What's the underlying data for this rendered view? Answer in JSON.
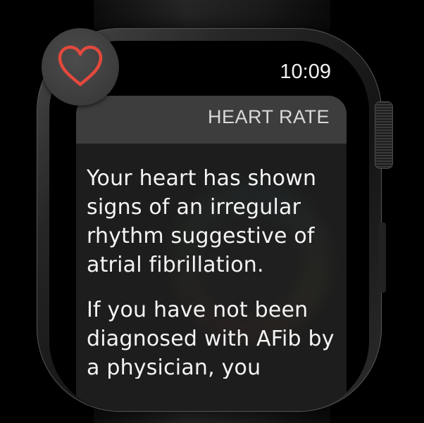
{
  "status": {
    "time": "10:09"
  },
  "notification": {
    "app_name": "HEART RATE",
    "app_icon": "heart-outline-icon",
    "icon_color": "#e2493c",
    "paragraphs": [
      "Your heart has shown signs of an irregular rhythm suggestive of atrial fibrillation.",
      "If you have not been diagnosed with AFib by a physician, you"
    ]
  }
}
